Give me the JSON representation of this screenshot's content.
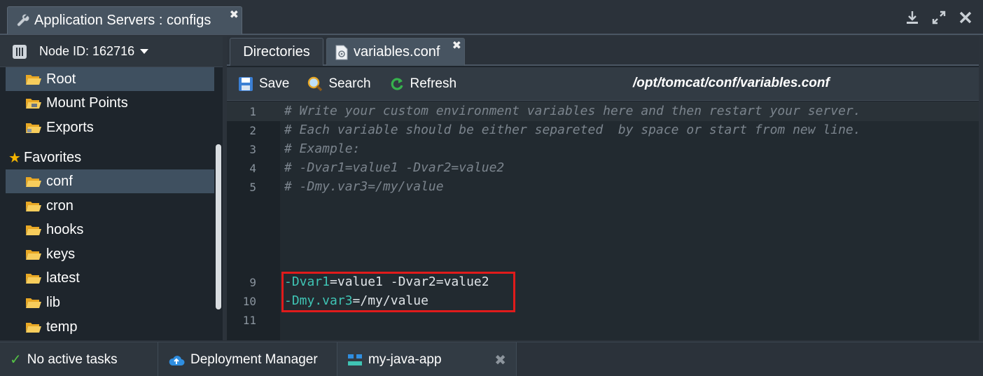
{
  "window": {
    "tab_title": "Application Servers : configs",
    "close_glyph": "✖"
  },
  "left": {
    "node_label": "Node ID: 162716",
    "tree": [
      "Root",
      "Mount Points",
      "Exports"
    ],
    "favorites_label": "Favorites",
    "favorites": [
      "conf",
      "cron",
      "hooks",
      "keys",
      "latest",
      "lib",
      "temp"
    ]
  },
  "right": {
    "tabs": {
      "directories": "Directories",
      "file": "variables.conf",
      "file_close": "✖"
    },
    "toolbar": {
      "save": "Save",
      "search": "Search",
      "refresh": "Refresh",
      "path": "/opt/tomcat/conf/variables.conf"
    }
  },
  "editor": {
    "lines": [
      {
        "num": "1",
        "text": "# Write your custom environment variables here and then restart your server."
      },
      {
        "num": "2",
        "text": "# Each variable should be either separeted  by space or start from new line."
      },
      {
        "num": "3",
        "text": "# Example:"
      },
      {
        "num": "4",
        "text": "# -Dvar1=value1 -Dvar2=value2"
      },
      {
        "num": "5",
        "text": "# -Dmy.var3=/my/value"
      }
    ],
    "code": {
      "line9_num": "9",
      "line9_key": "-Dvar1",
      "line9_rest": "=value1 -Dvar2=value2",
      "line10_num": "10",
      "line10_key": "-Dmy.var3",
      "line10_rest": "=/my/value",
      "line11_num": "11"
    }
  },
  "bottom": {
    "tasks": "No active tasks",
    "deployment": "Deployment Manager",
    "app": "my-java-app",
    "app_close": "✖"
  },
  "colors": {
    "accent": "#3fc4b4",
    "highlight_box": "#e01b1b",
    "selected_row": "#3f5060",
    "favorite_star": "#f4b400"
  }
}
